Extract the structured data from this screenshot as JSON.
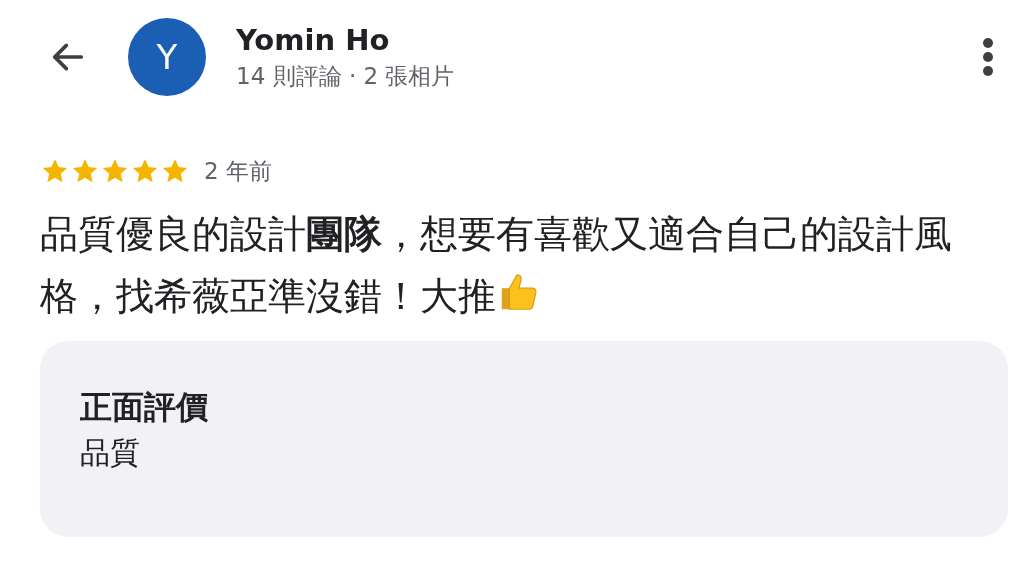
{
  "header": {
    "name": "Yomin Ho",
    "subtitle": "14 則評論 · 2 張相片",
    "avatar_letter": "Y"
  },
  "review": {
    "stars": 5,
    "time": "2 年前",
    "text": "品質優良的設計**團隊**，想要有喜歡又適合自己的設計風格，找希薇亞準沒錯！大推"
  },
  "highlights": {
    "title": "正面評價",
    "value": "品質"
  }
}
